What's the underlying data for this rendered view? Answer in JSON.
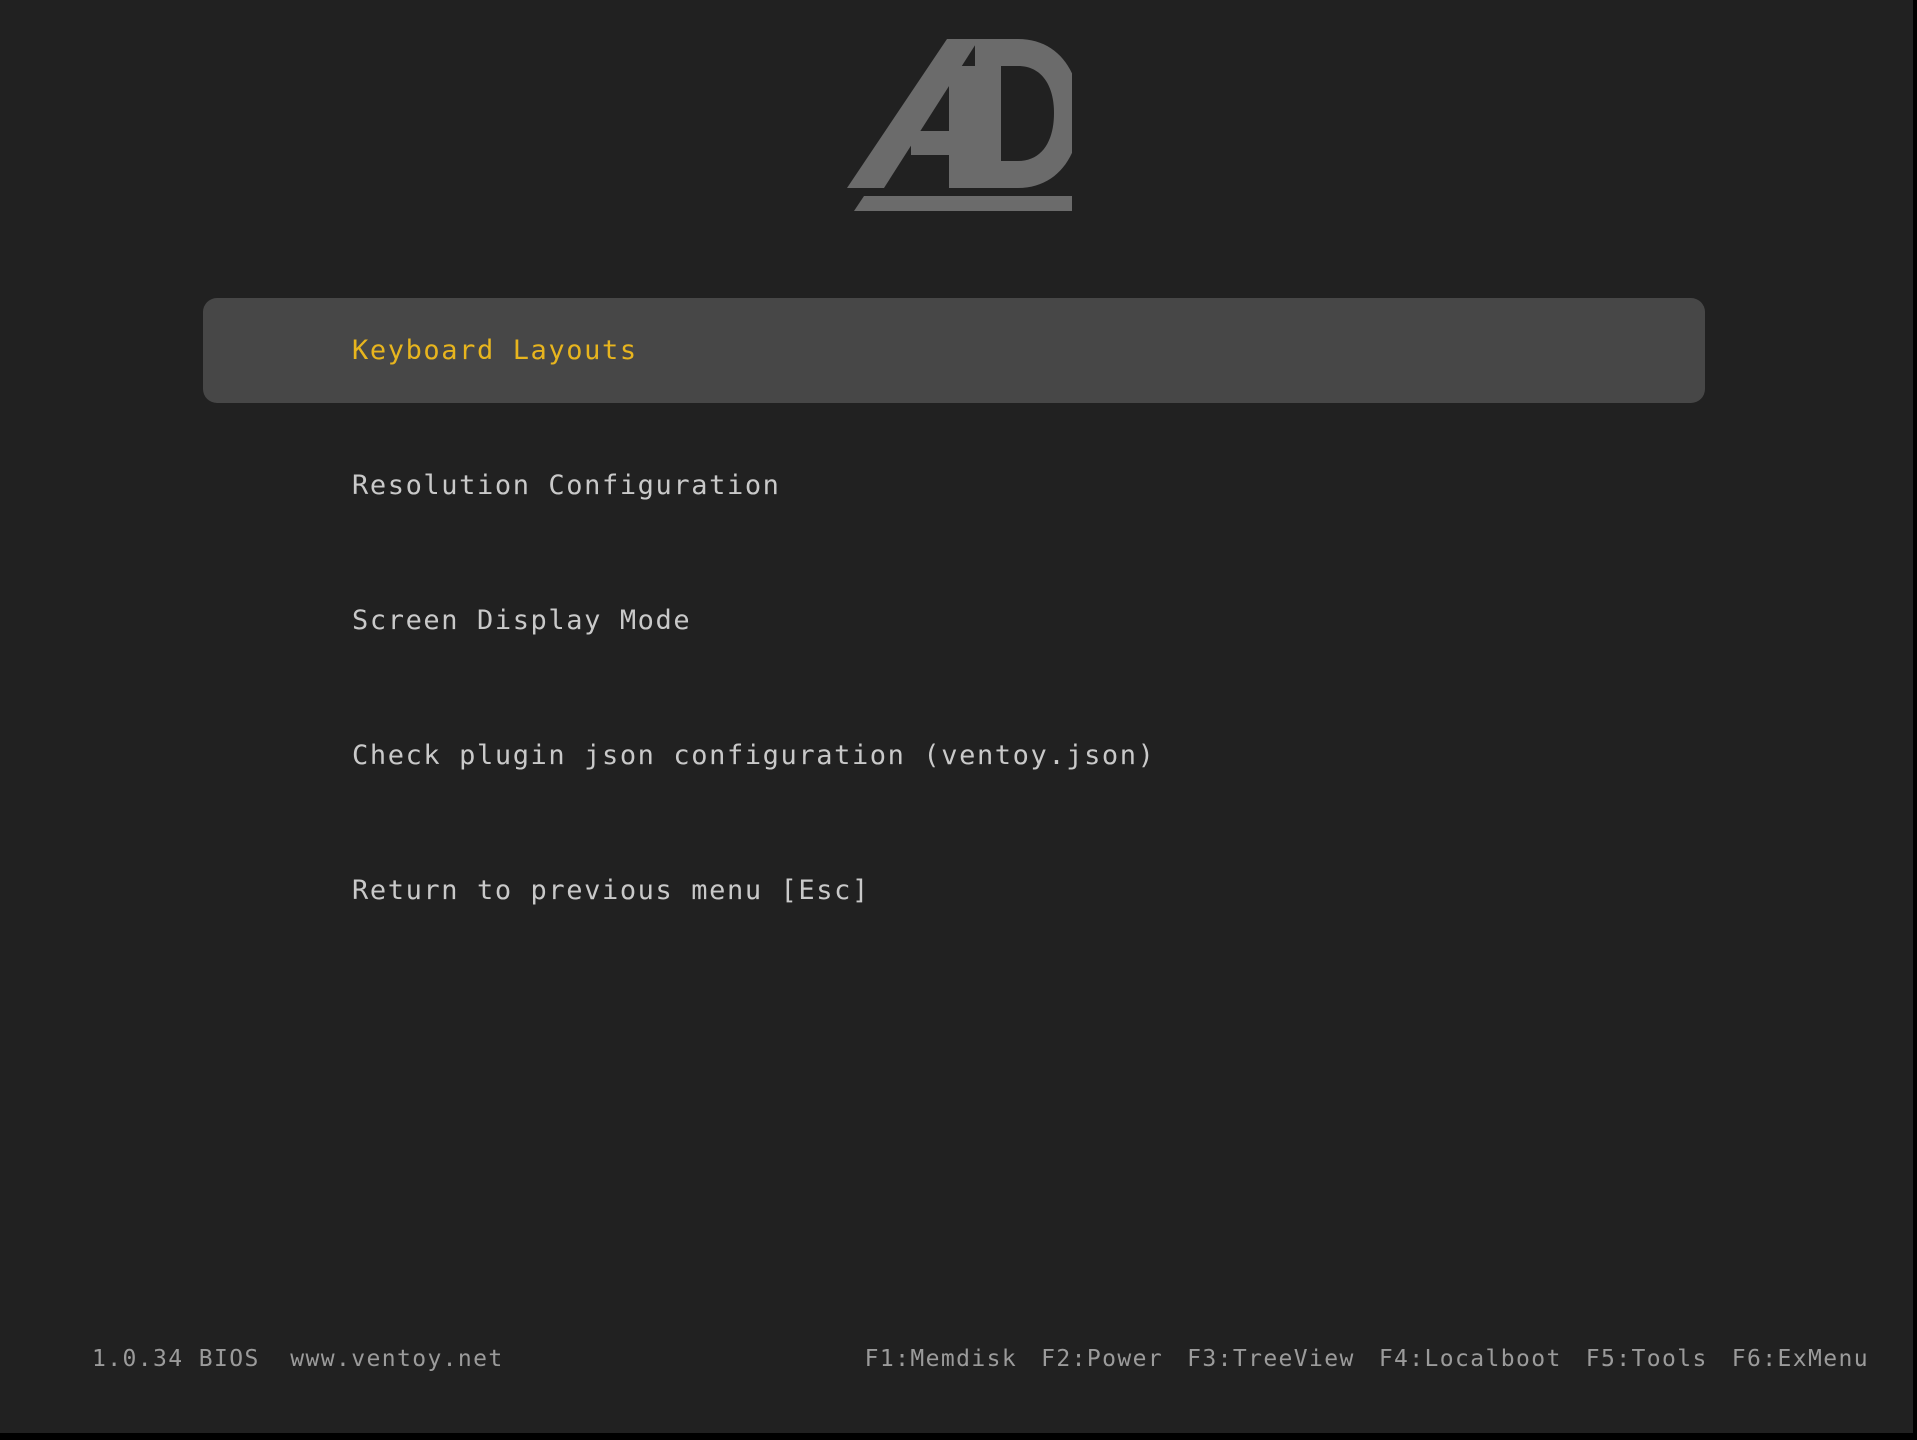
{
  "screen": {
    "background_color": "#212121",
    "border_color": "#000000"
  },
  "logo": {
    "name": "ad-monogram-logo",
    "alt_text": "AD",
    "color": "#6b6b6b"
  },
  "menu": {
    "highlight_color": "#474747",
    "selected_text_color": "#e8b51e",
    "text_color": "#c9c9c9",
    "selected_index": 0,
    "items": [
      {
        "label": "Keyboard Layouts"
      },
      {
        "label": "Resolution Configuration"
      },
      {
        "label": "Screen Display Mode"
      },
      {
        "label": "Check plugin json configuration (ventoy.json)"
      },
      {
        "label": "Return to previous menu [Esc]"
      }
    ]
  },
  "footer": {
    "text_color": "#9b9b9b",
    "version": "1.0.34 BIOS",
    "website": "www.ventoy.net",
    "left_text": "1.0.34 BIOS  www.ventoy.net",
    "function_keys": [
      {
        "label": "F1:Memdisk"
      },
      {
        "label": "F2:Power"
      },
      {
        "label": "F3:TreeView"
      },
      {
        "label": "F4:Localboot"
      },
      {
        "label": "F5:Tools"
      },
      {
        "label": "F6:ExMenu"
      }
    ]
  }
}
